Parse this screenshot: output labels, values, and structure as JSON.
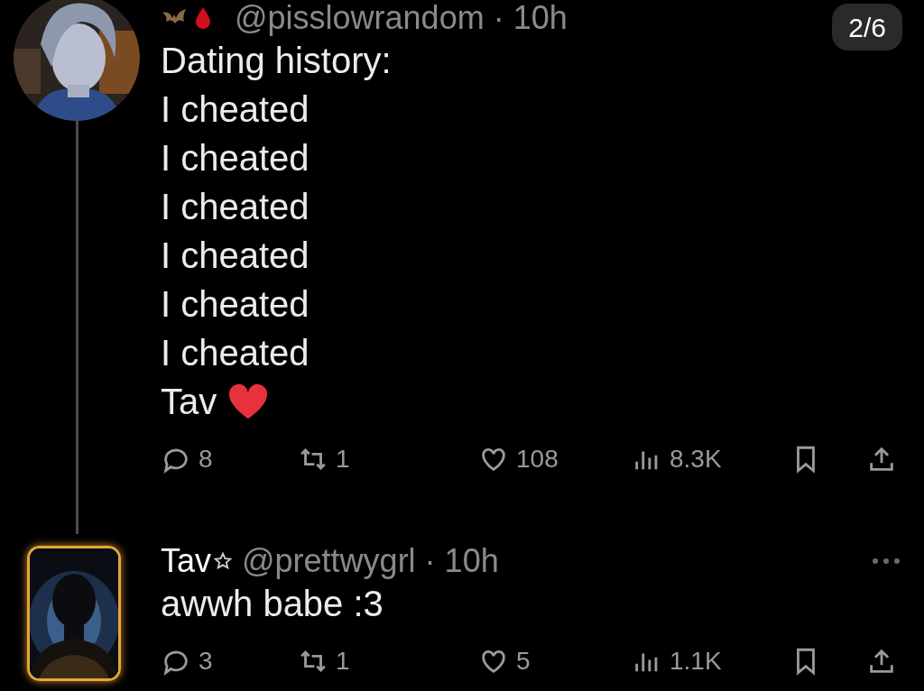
{
  "pagination": "2/6",
  "tweets": [
    {
      "kind": "post",
      "handle": "@pisslowrandom",
      "separator": "·",
      "time": "10h",
      "more_menu": false,
      "lines": [
        "Dating history:",
        "I cheated",
        "I cheated",
        "I cheated",
        "I cheated",
        "I cheated",
        "I cheated"
      ],
      "last_line": {
        "text": "Tav",
        "heart": true
      },
      "stats": {
        "replies": "8",
        "reposts": "1",
        "likes": "108",
        "views": "8.3K"
      }
    },
    {
      "kind": "reply",
      "name": "Tav",
      "star": true,
      "handle": "@prettwygrl",
      "separator": "·",
      "time": "10h",
      "more_menu": true,
      "lines": [
        "awwh babe :3"
      ],
      "stats": {
        "replies": "3",
        "reposts": "1",
        "likes": "5",
        "views": "1.1K"
      }
    }
  ]
}
